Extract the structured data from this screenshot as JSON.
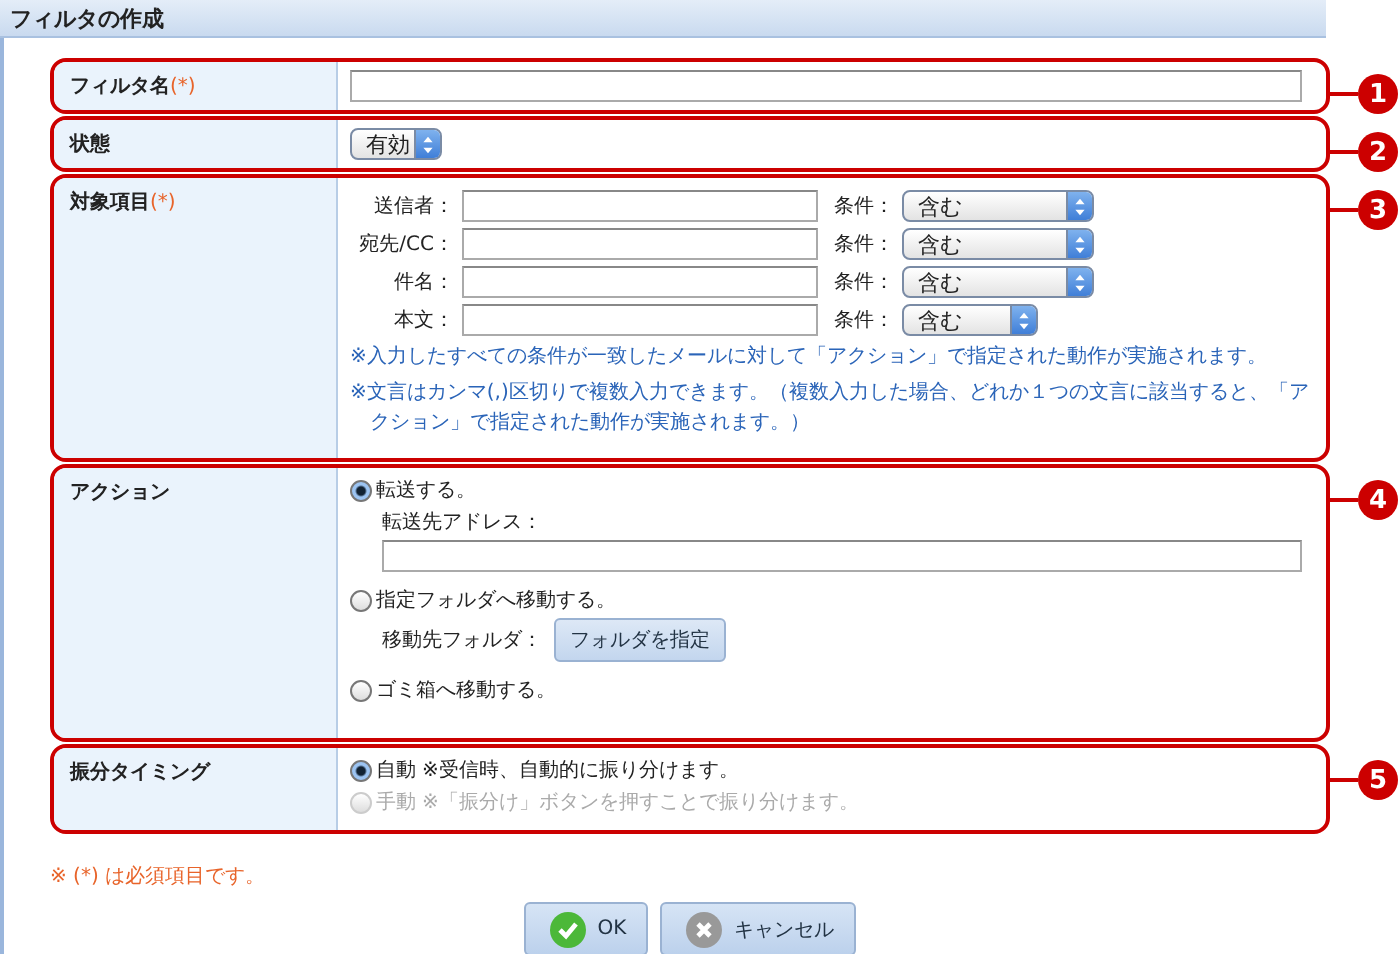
{
  "title": "フィルタの作成",
  "rows": [
    {
      "kind": "name",
      "label": "フィルタ名",
      "required": "(*)",
      "callout": "1"
    },
    {
      "kind": "status",
      "label": "状態",
      "select": "有効",
      "callout": "2"
    },
    {
      "kind": "targets",
      "label": "対象項目",
      "required": "(*)",
      "callout": "3",
      "fields": [
        {
          "label": "送信者：",
          "condition_label": "条件：",
          "condition": "含む"
        },
        {
          "label": "宛先/CC：",
          "condition_label": "条件：",
          "condition": "含む"
        },
        {
          "label": "件名：",
          "condition_label": "条件：",
          "condition": "含む"
        },
        {
          "label": "本文：",
          "condition_label": "条件：",
          "condition": "含む"
        }
      ],
      "notes": [
        "※入力したすべての条件が一致したメールに対して「アクション」で指定された動作が実施されます。",
        "※文言はカンマ(,)区切りで複数入力できます。（複数入力した場合、どれか１つの文言に該当すると、「アクション」で指定された動作が実施されます。）"
      ]
    },
    {
      "kind": "action",
      "label": "アクション",
      "callout": "4",
      "options": [
        {
          "label": "転送する。",
          "selected": true,
          "sub": {
            "kind": "field",
            "label": "転送先アドレス："
          }
        },
        {
          "label": "指定フォルダへ移動する。",
          "selected": false,
          "sub": {
            "kind": "button",
            "label": "移動先フォルダ：",
            "button": "フォルダを指定"
          }
        },
        {
          "label": "ゴミ箱へ移動する。",
          "selected": false
        }
      ]
    },
    {
      "kind": "timing",
      "label": "振分タイミング",
      "callout": "5",
      "options": [
        {
          "label": "自動",
          "note": "※受信時、自動的に振り分けます。",
          "selected": true,
          "disabled": false
        },
        {
          "label": "手動",
          "note": "※「振分け」ボタンを押すことで振り分けます。",
          "selected": false,
          "disabled": true
        }
      ]
    }
  ],
  "footnote": "※ (*) は必須項目です。",
  "buttons": [
    {
      "kind": "ok",
      "label": "OK"
    },
    {
      "kind": "cancel",
      "label": "キャンセル"
    }
  ]
}
